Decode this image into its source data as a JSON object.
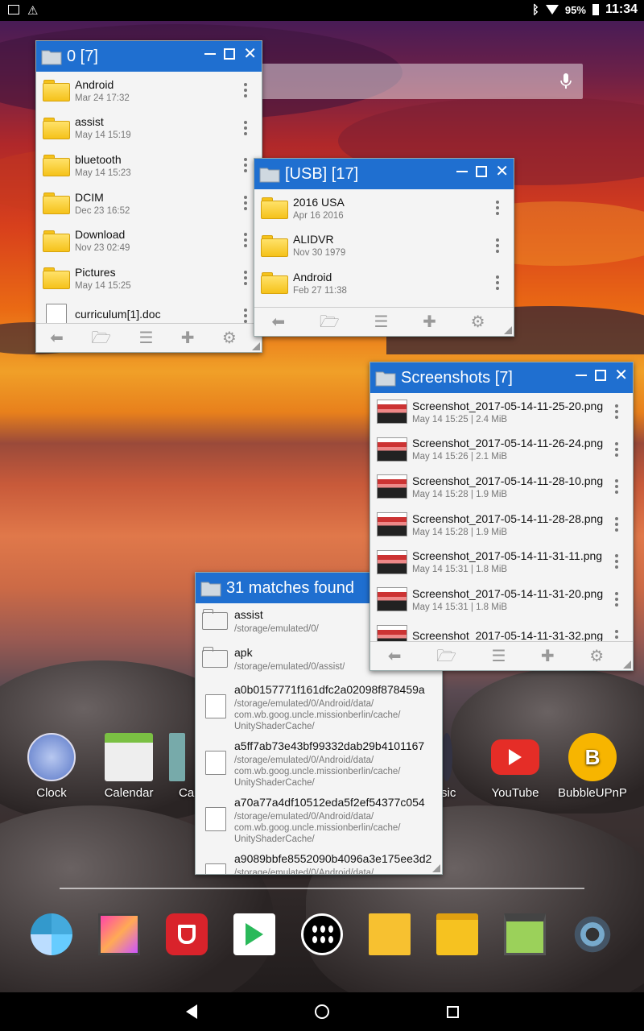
{
  "status": {
    "time": "11:34",
    "battery": "95%"
  },
  "win0": {
    "title": "0 [7]",
    "items": [
      {
        "name": "Android",
        "sub": "Mar 24 17:32"
      },
      {
        "name": "assist",
        "sub": "May 14 15:19"
      },
      {
        "name": "bluetooth",
        "sub": "May 14 15:23"
      },
      {
        "name": "DCIM",
        "sub": "Dec 23 16:52"
      },
      {
        "name": "Download",
        "sub": "Nov 23 02:49"
      },
      {
        "name": "Pictures",
        "sub": "May 14 15:25"
      },
      {
        "name": "curriculum[1].doc",
        "sub": ""
      }
    ]
  },
  "winusb": {
    "title": "[USB] [17]",
    "items": [
      {
        "name": "2016 USA",
        "sub": "Apr 16 2016"
      },
      {
        "name": "ALIDVR",
        "sub": "Nov 30 1979"
      },
      {
        "name": "Android",
        "sub": "Feb 27 11:38"
      }
    ]
  },
  "winshots": {
    "title": "Screenshots [7]",
    "items": [
      {
        "name": "Screenshot_2017-05-14-11-25-20.png",
        "sub": "May 14 15:25 | 2.4 MiB"
      },
      {
        "name": "Screenshot_2017-05-14-11-26-24.png",
        "sub": "May 14 15:26 | 2.1 MiB"
      },
      {
        "name": "Screenshot_2017-05-14-11-28-10.png",
        "sub": "May 14 15:28 | 1.9 MiB"
      },
      {
        "name": "Screenshot_2017-05-14-11-28-28.png",
        "sub": "May 14 15:28 | 1.9 MiB"
      },
      {
        "name": "Screenshot_2017-05-14-11-31-11.png",
        "sub": "May 14 15:31 | 1.8 MiB"
      },
      {
        "name": "Screenshot_2017-05-14-11-31-20.png",
        "sub": "May 14 15:31 | 1.8 MiB"
      },
      {
        "name": "Screenshot_2017-05-14-11-31-32.png",
        "sub": ""
      }
    ]
  },
  "winsearch": {
    "title": "31 matches found",
    "items": [
      {
        "name": "assist",
        "lines": [
          "/storage/emulated/0/"
        ]
      },
      {
        "name": "apk",
        "lines": [
          "/storage/emulated/0/assist/"
        ]
      },
      {
        "name": "a0b0157771f161dfc2a02098f878459a",
        "lines": [
          "/storage/emulated/0/Android/data/",
          "com.wb.goog.uncle.missionberlin/cache/",
          "UnityShaderCache/"
        ]
      },
      {
        "name": "a5ff7ab73e43bf99332dab29b4101167",
        "lines": [
          "/storage/emulated/0/Android/data/",
          "com.wb.goog.uncle.missionberlin/cache/",
          "UnityShaderCache/"
        ]
      },
      {
        "name": "a70a77a4df10512eda5f2ef54377c054",
        "lines": [
          "/storage/emulated/0/Android/data/",
          "com.wb.goog.uncle.missionberlin/cache/",
          "UnityShaderCache/"
        ]
      },
      {
        "name": "a9089bbfe8552090b4096a3e175ee3d2",
        "lines": [
          "/storage/emulated/0/Android/data/"
        ]
      }
    ]
  },
  "apps": [
    "Clock",
    "Calendar",
    "Ca",
    "sic",
    "YouTube",
    "BubbleUPnP"
  ]
}
